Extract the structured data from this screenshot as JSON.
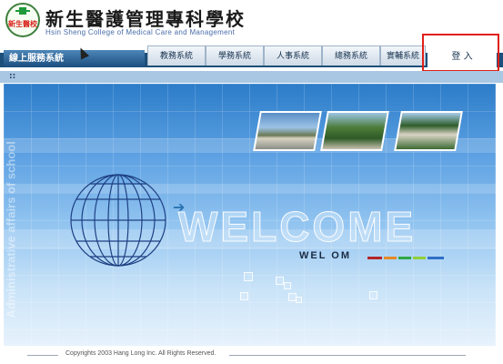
{
  "header": {
    "logo_text": "新生醫校",
    "title": "新生醫護管理專科學校",
    "subtitle": "Hsin Sheng College of Medical Care and Management"
  },
  "nav": {
    "service_label": "線上服務系統",
    "tabs": [
      {
        "label": "教務系統"
      },
      {
        "label": "學務系統"
      },
      {
        "label": "人事系統"
      },
      {
        "label": "總務系統"
      },
      {
        "label": "實輔系統"
      }
    ],
    "login_label": "登 入"
  },
  "subbar": {
    "marker": "::"
  },
  "main": {
    "vertical_text": "Administrative affairs of school",
    "welcome_big": "WELCOME",
    "welcome_small": "WEL OM",
    "color_bars": [
      "#b3262a",
      "#e58a25",
      "#2fa843",
      "#8fcf3a",
      "#2f6fc4"
    ]
  },
  "footer": {
    "copyright": "Copyrights 2003 Hang Long Inc. All Rights Reserved."
  },
  "icons": {
    "cursor": "arrow-cursor-icon",
    "globe": "globe-icon",
    "arrow": "double-arrow-icon"
  },
  "colors": {
    "nav_strip": "#1c4f7a",
    "highlight": "#e0201a",
    "panel_top": "#2c7cc9"
  }
}
